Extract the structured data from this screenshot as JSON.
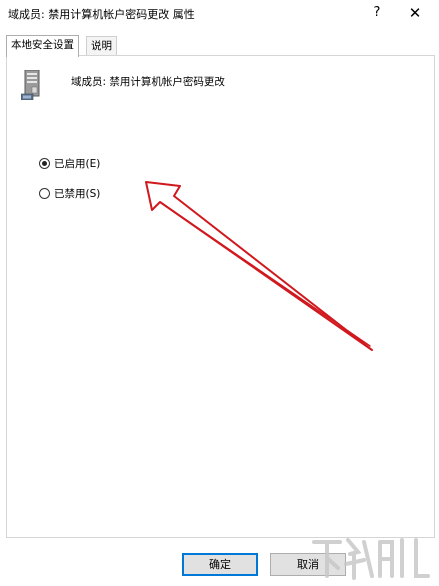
{
  "window": {
    "title": "域成员: 禁用计算机帐户密码更改 属性",
    "help_glyph": "?",
    "close_glyph": "✕"
  },
  "tabs": [
    {
      "label": "本地安全设置",
      "active": true
    },
    {
      "label": "说明",
      "active": false
    }
  ],
  "policy": {
    "icon": "server-computer-icon",
    "name": "域成员: 禁用计算机帐户密码更改"
  },
  "options": [
    {
      "label": "已启用(E)",
      "checked": true
    },
    {
      "label": "已禁用(S)",
      "checked": false
    }
  ],
  "buttons": {
    "ok_label": "确定",
    "cancel_label": "取消"
  },
  "annotation": {
    "type": "red-arrow",
    "points_to": "已启用(E)",
    "color": "#d0181e"
  },
  "colors": {
    "focus_border": "#0078d7",
    "button_bg": "#e1e1e1"
  }
}
